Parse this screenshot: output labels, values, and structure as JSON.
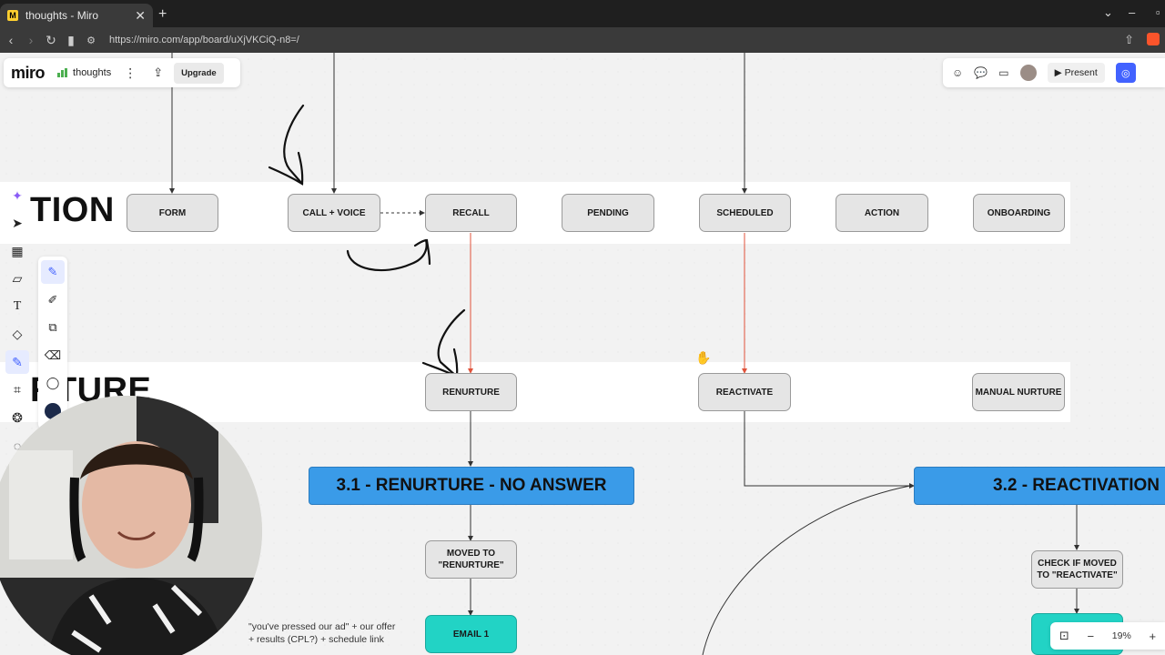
{
  "browser": {
    "tab_title": "thoughts - Miro",
    "favicon_letter": "M",
    "tab_close": "✕",
    "new_tab": "+",
    "url": "https://miro.com/app/board/uXjVKCiQ-n8=/",
    "win_min": "–",
    "win_max": "▫",
    "menu_chevron": "⌄"
  },
  "miro": {
    "logo": "miro",
    "board_name": "thoughts",
    "upgrade_label": "Upgrade",
    "present_label": "Present",
    "zoom": "19%"
  },
  "lanes": {
    "top_title": "TION",
    "mid_title": "RTURE"
  },
  "nodes": {
    "form": "FORM",
    "call_voice": "CALL + VOICE",
    "recall": "RECALL",
    "pending": "PENDING",
    "scheduled": "SCHEDULED",
    "action": "ACTION",
    "onboarding": "ONBOARDING",
    "renurture": "RENURTURE",
    "reactivate": "REACTIVATE",
    "manual_nurture": "MANUAL NURTURE",
    "moved_to_renurture_1": "MOVED TO",
    "moved_to_renurture_2": "\"RENURTURE\"",
    "check_moved_1": "CHECK IF MOVED",
    "check_moved_2": "TO \"REACTIVATE\"",
    "email_1": "EMAIL 1"
  },
  "sections": {
    "renurture_no_answer": "3.1 - RENURTURE - NO ANSWER",
    "reactivation": "3.2 - REACTIVATION"
  },
  "notes": {
    "email_note_1": "\"you've pressed our ad\" + our offer",
    "email_note_2": "+ results (CPL?) + schedule link"
  },
  "colors": {
    "section_blue": "#3a9be8",
    "email_teal": "#22d3c5",
    "flow_red": "#e0533b",
    "miro_accent": "#4262ff"
  }
}
